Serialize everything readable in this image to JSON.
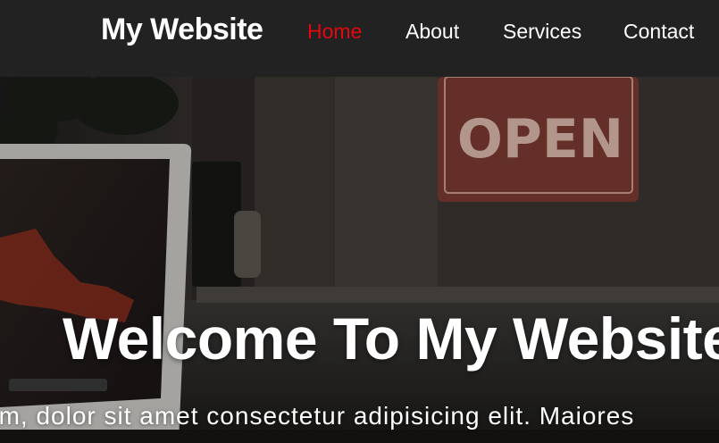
{
  "navbar": {
    "brand": "My Website",
    "links": [
      {
        "label": "Home",
        "active": true
      },
      {
        "label": "About",
        "active": false
      },
      {
        "label": "Services",
        "active": false
      },
      {
        "label": "Contact",
        "active": false
      }
    ]
  },
  "hero": {
    "title": "Welcome To My Website",
    "text": "um, dolor sit amet consectetur adipisicing elit. Maiores",
    "sign_text": "OPEN"
  },
  "colors": {
    "navbar_bg": "#222222",
    "active_link": "#e3070f",
    "text": "#ffffff"
  }
}
